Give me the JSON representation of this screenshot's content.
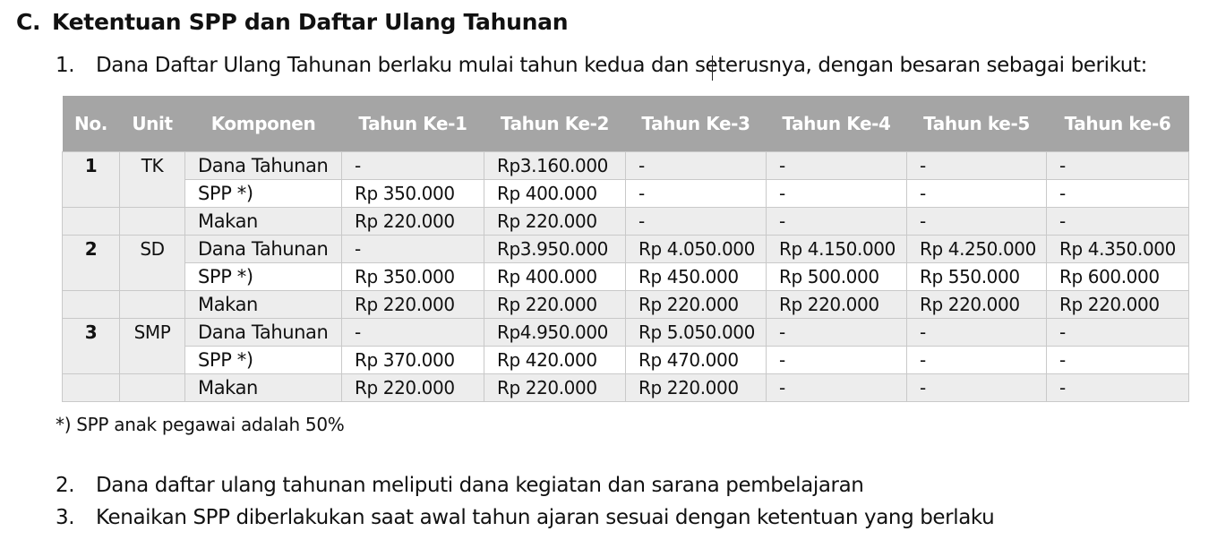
{
  "section": {
    "letter": "C.",
    "title": "Ketentuan SPP dan Daftar Ulang Tahunan"
  },
  "items": [
    {
      "num": "1.",
      "text_a": "Dana Daftar Ulang Tahunan berlaku mulai tahun kedua dan seterusnya, dengan besaran sebagai berikut:"
    },
    {
      "num": "2.",
      "text": "Dana daftar ulang tahunan meliputi dana kegiatan dan sarana pembelajaran"
    },
    {
      "num": "3.",
      "text": "Kenaikan SPP diberlakukan saat awal tahun ajaran sesuai dengan ketentuan yang berlaku"
    }
  ],
  "table": {
    "headers": [
      "No.",
      "Unit",
      "Komponen",
      "Tahun Ke-1",
      "Tahun Ke-2",
      "Tahun Ke-3",
      "Tahun Ke-4",
      "Tahun ke-5",
      "Tahun ke-6"
    ],
    "rows": [
      {
        "no": "1",
        "unit": "TK",
        "komponen": "Dana Tahunan",
        "values": [
          "-",
          "Rp3.160.000",
          "-",
          "-",
          "-",
          "-"
        ]
      },
      {
        "no": "",
        "unit": "",
        "komponen": "SPP *)",
        "values": [
          "Rp 350.000",
          "Rp 400.000",
          "-",
          "-",
          "-",
          "-"
        ]
      },
      {
        "no": "",
        "unit": "",
        "komponen": "Makan",
        "values": [
          "Rp 220.000",
          "Rp 220.000",
          "-",
          "-",
          "-",
          "-"
        ]
      },
      {
        "no": "2",
        "unit": "SD",
        "komponen": "Dana Tahunan",
        "values": [
          "-",
          "Rp3.950.000",
          "Rp 4.050.000",
          "Rp 4.150.000",
          "Rp 4.250.000",
          "Rp 4.350.000"
        ]
      },
      {
        "no": "",
        "unit": "",
        "komponen": "SPP *)",
        "values": [
          "Rp 350.000",
          "Rp 400.000",
          "Rp 450.000",
          "Rp 500.000",
          "Rp 550.000",
          "Rp 600.000"
        ]
      },
      {
        "no": "",
        "unit": "",
        "komponen": "Makan",
        "values": [
          "Rp 220.000",
          "Rp 220.000",
          "Rp 220.000",
          "Rp 220.000",
          "Rp 220.000",
          "Rp 220.000"
        ]
      },
      {
        "no": "3",
        "unit": "SMP",
        "komponen": "Dana Tahunan",
        "values": [
          "-",
          "Rp4.950.000",
          "Rp 5.050.000",
          "-",
          "-",
          "-"
        ]
      },
      {
        "no": "",
        "unit": "",
        "komponen": "SPP *)",
        "values": [
          "Rp 370.000",
          "Rp 420.000",
          "Rp 470.000",
          "-",
          "-",
          "-"
        ]
      },
      {
        "no": "",
        "unit": "",
        "komponen": "Makan",
        "values": [
          "Rp 220.000",
          "Rp 220.000",
          "Rp 220.000",
          "-",
          "-",
          "-"
        ]
      }
    ]
  },
  "footnote": "*) SPP anak pegawai adalah 50%",
  "colors": {
    "header_bg": "#a5a5a5",
    "row_shade": "#ededed",
    "border": "#c9c9c9"
  }
}
